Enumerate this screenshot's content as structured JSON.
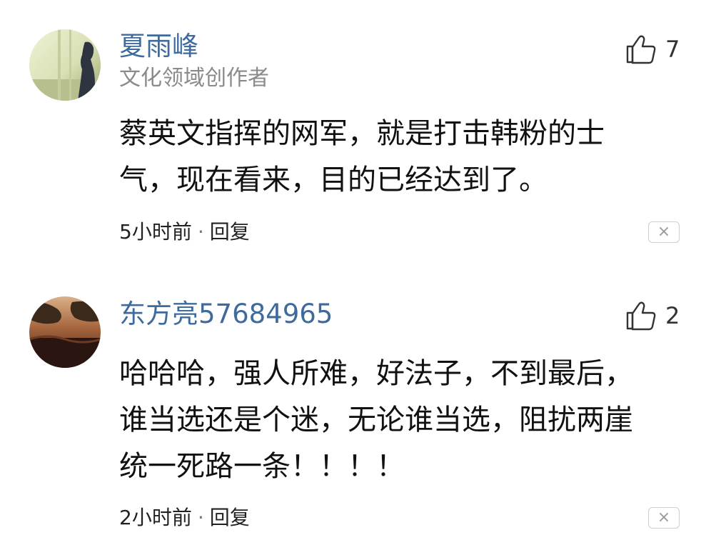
{
  "comments": [
    {
      "username": "夏雨峰",
      "subtitle": "文化领域创作者",
      "likes": "7",
      "text_lines": [
        "蔡英文指挥的网军，就是打击韩粉的士",
        "气，现在看来，目的已经达到了。"
      ],
      "time": "5小时前",
      "separator": "·",
      "reply": "回复",
      "dismiss": "×"
    },
    {
      "username": "东方亮57684965",
      "likes": "2",
      "text_lines": [
        "哈哈哈，强人所难，好法子，不到最后，",
        "谁当选还是个迷，无论谁当选，阻扰两崖",
        "统一死路一条！！！！"
      ],
      "time": "2小时前",
      "separator": "·",
      "reply": "回复",
      "dismiss": "×"
    }
  ],
  "icons": {
    "like": "thumbs-up-icon",
    "dismiss": "close-icon"
  },
  "colors": {
    "username": "#3f6a9c",
    "subtitle": "#8a8a8a",
    "text": "#111111",
    "border": "#cfcfcf"
  }
}
